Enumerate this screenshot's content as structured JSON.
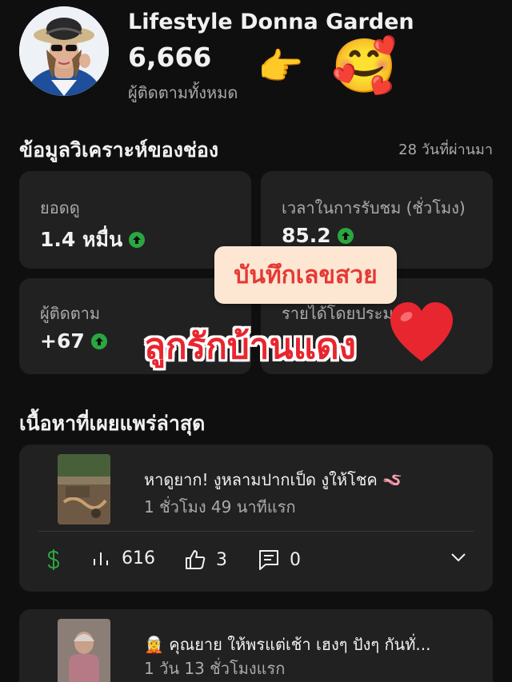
{
  "channel": {
    "name": "Lifestyle Donna Garden",
    "subscribers": "6,666",
    "subscribers_label": "ผู้ติดตามทั้งหมด",
    "emoji_hand": "👉",
    "emoji_love": "🥰"
  },
  "analytics": {
    "title": "ข้อมูลวิเคราะห์ของช่อง",
    "period": "28 วันที่ผ่านมา",
    "cards": [
      {
        "label": "ยอดดู",
        "value": "1.4 หมื่น"
      },
      {
        "label": "เวลาในการรับชม (ชั่วโมง)",
        "value": "85.2"
      },
      {
        "label": "ผู้ติดตาม",
        "value": "+67"
      },
      {
        "label": "รายได้โดยประมาณ",
        "value": ""
      }
    ]
  },
  "overlay": {
    "note": "บันทึกเลขสวย",
    "big_text": "ลูกรักบ้านแดง"
  },
  "latest": {
    "title": "เนื้อหาที่เผยแพร่ล่าสุด",
    "videos": [
      {
        "title": "หาดูยาก! งูหลามปากเป็ด งูให้โชค 🪱",
        "time": "1 ชั่วโมง 49 นาทีแรก",
        "views": "616",
        "likes": "3",
        "comments": "0"
      },
      {
        "title": "🧝 คุณยาย ให้พรแต่เช้า เฮงๆ ปังๆ กันทั่...",
        "time": "1 วัน 13 ชั่วโมงแรก"
      }
    ]
  },
  "colors": {
    "background": "#0f0f0f",
    "card": "#212121",
    "up_indicator": "#2ba640",
    "revenue_icon": "#2ba640",
    "sticker_text": "#e8262f"
  }
}
